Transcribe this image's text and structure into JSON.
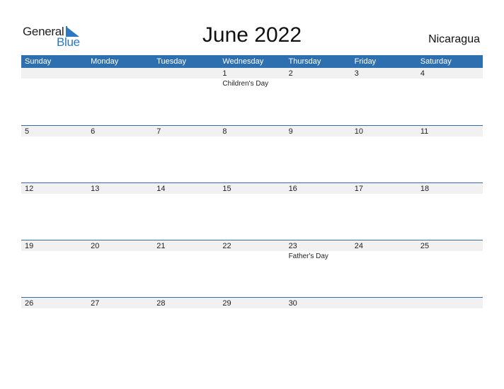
{
  "logo": {
    "general": "General",
    "blue": "Blue"
  },
  "title": "June 2022",
  "country": "Nicaragua",
  "colors": {
    "accent": "#2e6fb0",
    "number_row": "#f1f1f1",
    "logo_blue": "#2e78c2"
  },
  "weekdays": [
    "Sunday",
    "Monday",
    "Tuesday",
    "Wednesday",
    "Thursday",
    "Friday",
    "Saturday"
  ],
  "weeks": [
    [
      {
        "num": "",
        "event": ""
      },
      {
        "num": "",
        "event": ""
      },
      {
        "num": "",
        "event": ""
      },
      {
        "num": "1",
        "event": "Children's Day"
      },
      {
        "num": "2",
        "event": ""
      },
      {
        "num": "3",
        "event": ""
      },
      {
        "num": "4",
        "event": ""
      }
    ],
    [
      {
        "num": "5",
        "event": ""
      },
      {
        "num": "6",
        "event": ""
      },
      {
        "num": "7",
        "event": ""
      },
      {
        "num": "8",
        "event": ""
      },
      {
        "num": "9",
        "event": ""
      },
      {
        "num": "10",
        "event": ""
      },
      {
        "num": "11",
        "event": ""
      }
    ],
    [
      {
        "num": "12",
        "event": ""
      },
      {
        "num": "13",
        "event": ""
      },
      {
        "num": "14",
        "event": ""
      },
      {
        "num": "15",
        "event": ""
      },
      {
        "num": "16",
        "event": ""
      },
      {
        "num": "17",
        "event": ""
      },
      {
        "num": "18",
        "event": ""
      }
    ],
    [
      {
        "num": "19",
        "event": ""
      },
      {
        "num": "20",
        "event": ""
      },
      {
        "num": "21",
        "event": ""
      },
      {
        "num": "22",
        "event": ""
      },
      {
        "num": "23",
        "event": "Father's Day"
      },
      {
        "num": "24",
        "event": ""
      },
      {
        "num": "25",
        "event": ""
      }
    ],
    [
      {
        "num": "26",
        "event": ""
      },
      {
        "num": "27",
        "event": ""
      },
      {
        "num": "28",
        "event": ""
      },
      {
        "num": "29",
        "event": ""
      },
      {
        "num": "30",
        "event": ""
      },
      {
        "num": "",
        "event": ""
      },
      {
        "num": "",
        "event": ""
      }
    ]
  ]
}
